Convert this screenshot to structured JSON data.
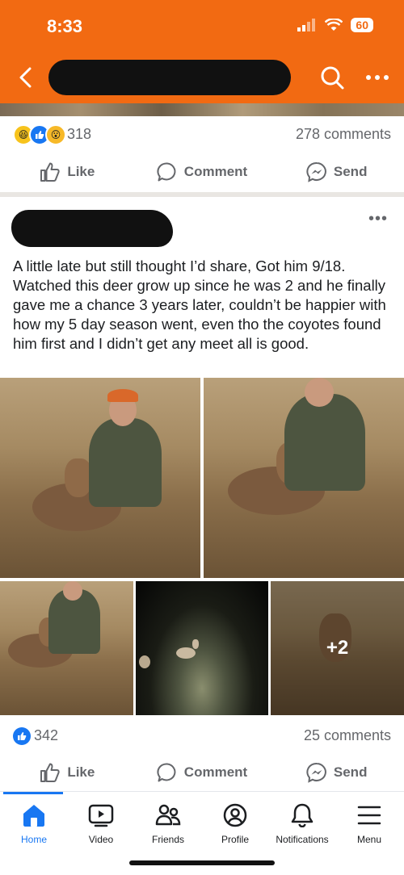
{
  "status": {
    "time": "8:33",
    "battery": "60"
  },
  "prev_post": {
    "reactions_count": "318",
    "comments": "278 comments",
    "actions": {
      "like": "Like",
      "comment": "Comment",
      "send": "Send"
    }
  },
  "post": {
    "text": "A little late but still thought I’d share, Got him 9/18. Watched this deer grow up since he was 2 and he finally gave me a chance 3 years later, couldn’t be happier with how my 5 day season went, even tho the coyotes found him first and I didn’t get any meet all is good.",
    "more_photos": "+2",
    "likes": "342",
    "comments": "25 comments",
    "actions": {
      "like": "Like",
      "comment": "Comment",
      "send": "Send"
    }
  },
  "tabs": [
    {
      "label": "Home",
      "icon": "home-icon"
    },
    {
      "label": "Video",
      "icon": "video-icon"
    },
    {
      "label": "Friends",
      "icon": "friends-icon"
    },
    {
      "label": "Profile",
      "icon": "profile-icon"
    },
    {
      "label": "Notifications",
      "icon": "bell-icon"
    },
    {
      "label": "Menu",
      "icon": "menu-icon"
    }
  ],
  "colors": {
    "header": "#f26a12",
    "accent": "#1877f2",
    "secondary_text": "#65676b"
  }
}
